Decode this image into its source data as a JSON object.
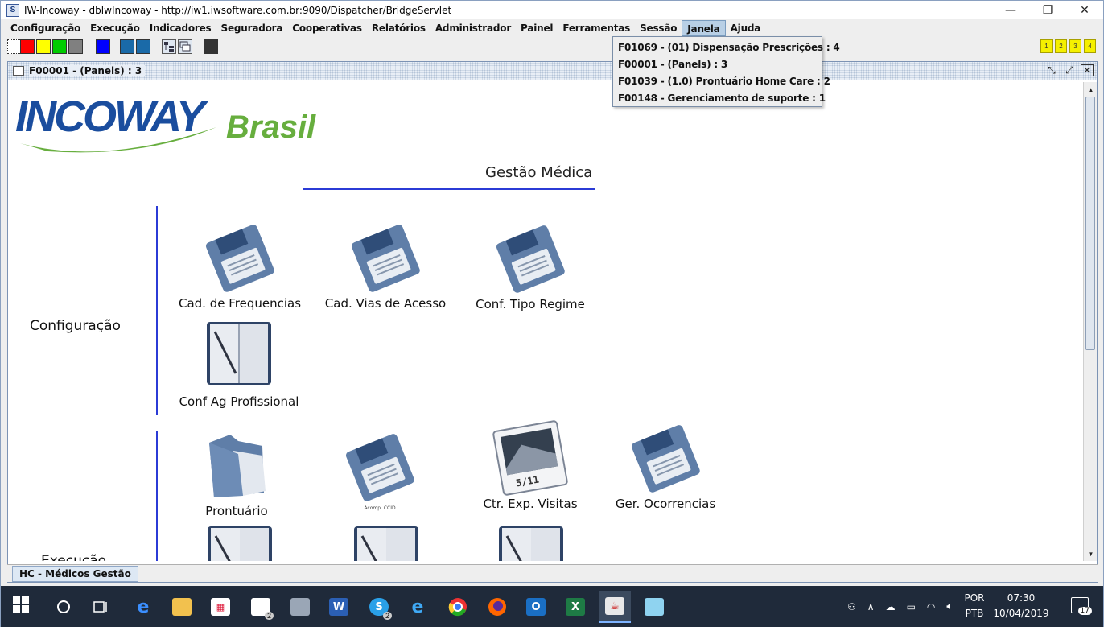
{
  "window": {
    "title": "IW-Incoway - dblwIncoway - http://iw1.iwsoftware.com.br:9090/Dispatcher/BridgeServlet",
    "controls": [
      "—",
      "❐",
      "✕"
    ]
  },
  "menubar": {
    "items": [
      "Configuração",
      "Execução",
      "Indicadores",
      "Seguradora",
      "Cooperativas",
      "Relatórios",
      "Administrador",
      "Painel",
      "Ferramentas",
      "Sessão",
      "Janela",
      "Ajuda"
    ],
    "active": "Janela"
  },
  "toolbar": {
    "colors": [
      "#ff0000",
      "#ffff00",
      "#00cc00",
      "#808080",
      "#0000ff",
      "#1a5ea8",
      "#1a5ea8"
    ],
    "right_buttons": [
      "1",
      "2",
      "3",
      "4"
    ]
  },
  "dropdown": {
    "items": [
      "F01069 - (01) Dispensação Prescrições : 4",
      "F00001 - (Panels) : 3",
      "F01039 - (1.0) Prontuário Home Care : 2",
      "F00148 - Gerenciamento de suporte : 1"
    ]
  },
  "frame": {
    "title": "F00001 - (Panels) : 3"
  },
  "logo": {
    "main": "INCOWAY",
    "sub": "Brasil"
  },
  "panel": {
    "heading": "Gestão Médica",
    "groups": [
      {
        "label": "Configuração",
        "tiles": [
          {
            "label": "Cad. de Frequencias",
            "icon": "floppy-disk-icon"
          },
          {
            "label": "Cad. Vias de Acesso",
            "icon": "floppy-disk-icon"
          },
          {
            "label": "Conf. Tipo Regime",
            "icon": "floppy-disk-icon"
          },
          {
            "label": "Conf Ag Profissional",
            "icon": "notebook-icon"
          }
        ]
      },
      {
        "label": "Execução",
        "tiles": [
          {
            "label": "Prontuário",
            "icon": "folder-icon"
          },
          {
            "label": "Acomp. CCID",
            "icon": "floppy-disk-icon"
          },
          {
            "label": "Ctr. Exp. Visitas",
            "icon": "photo-icon",
            "photo_text": "5/11"
          },
          {
            "label": "Ger. Ocorrencias",
            "icon": "floppy-disk-icon"
          }
        ]
      }
    ]
  },
  "bottom_tab": {
    "label": "HC - Médicos Gestão"
  },
  "taskbar": {
    "apps": [
      {
        "name": "search",
        "badge": ""
      },
      {
        "name": "task-view",
        "badge": ""
      },
      {
        "name": "edge",
        "badge": ""
      },
      {
        "name": "file-explorer",
        "badge": ""
      },
      {
        "name": "store",
        "badge": ""
      },
      {
        "name": "mail",
        "badge": "2"
      },
      {
        "name": "app-gray",
        "badge": ""
      },
      {
        "name": "word",
        "badge": ""
      },
      {
        "name": "skype",
        "badge": "2"
      },
      {
        "name": "internet-explorer",
        "badge": ""
      },
      {
        "name": "chrome",
        "badge": ""
      },
      {
        "name": "firefox",
        "badge": ""
      },
      {
        "name": "outlook",
        "badge": ""
      },
      {
        "name": "excel",
        "badge": ""
      },
      {
        "name": "java",
        "badge": ""
      },
      {
        "name": "app-notes",
        "badge": ""
      }
    ],
    "language_top": "POR",
    "language_bottom": "PTB",
    "time": "07:30",
    "date": "10/04/2019",
    "notification_count": "17"
  }
}
